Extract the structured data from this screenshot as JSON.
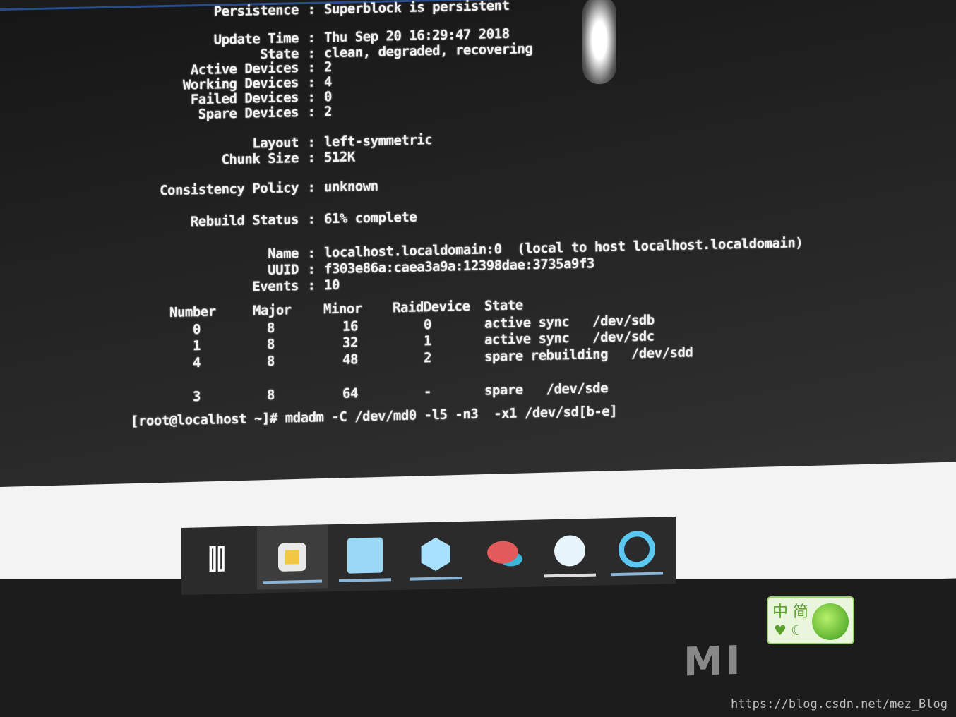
{
  "details": [
    {
      "key": "Persistence",
      "value": "Superblock is persistent"
    },
    {
      "key": "Update Time",
      "value": "Thu Sep 20 16:29:47 2018"
    },
    {
      "key": "State",
      "value": "clean, degraded, recovering"
    },
    {
      "key": "Active Devices",
      "value": "2"
    },
    {
      "key": "Working Devices",
      "value": "4"
    },
    {
      "key": "Failed Devices",
      "value": "0"
    },
    {
      "key": "Spare Devices",
      "value": "2"
    },
    {
      "key": "Layout",
      "value": "left-symmetric"
    },
    {
      "key": "Chunk Size",
      "value": "512K"
    },
    {
      "key": "Consistency Policy",
      "value": "unknown"
    },
    {
      "key": "Rebuild Status",
      "value": "61% complete"
    },
    {
      "key": "Name",
      "value": "localhost.localdomain:0  (local to host localhost.localdomain)"
    },
    {
      "key": "UUID",
      "value": "f303e86a:caea3a9a:12398dae:3735a9f3"
    },
    {
      "key": "Events",
      "value": "10"
    }
  ],
  "separator": ":",
  "table": {
    "headers": [
      "Number",
      "Major",
      "Minor",
      "RaidDevice",
      "State"
    ],
    "rows": [
      [
        "0",
        "8",
        "16",
        "0",
        "active sync   /dev/sdb"
      ],
      [
        "1",
        "8",
        "32",
        "1",
        "active sync   /dev/sdc"
      ],
      [
        "4",
        "8",
        "48",
        "2",
        "spare rebuilding   /dev/sdd"
      ],
      [
        "3",
        "8",
        "64",
        "-",
        "spare   /dev/sde"
      ]
    ]
  },
  "prompt": "[root@localhost ~]# mdadm -C /dev/md0 -l5 -n3  -x1 /dev/sd[b-e]",
  "taskbar": {
    "icons": [
      "task-view-icon",
      "file-explorer-icon",
      "app-window-icon",
      "hexagon-app-icon",
      "paint-app-icon",
      "video-app-icon",
      "browser-app-icon"
    ]
  },
  "brand_logo": "MI",
  "watermark": "https://blog.csdn.net/mez_Blog",
  "badge": {
    "text": "中 简",
    "icons": "♥ ☾"
  },
  "colors": {
    "terminal_bg": "#1e1e1e",
    "terminal_text": "#f2f2f2",
    "taskbar": "#2b2b2b",
    "accent_underline": "#8ab4d8"
  }
}
